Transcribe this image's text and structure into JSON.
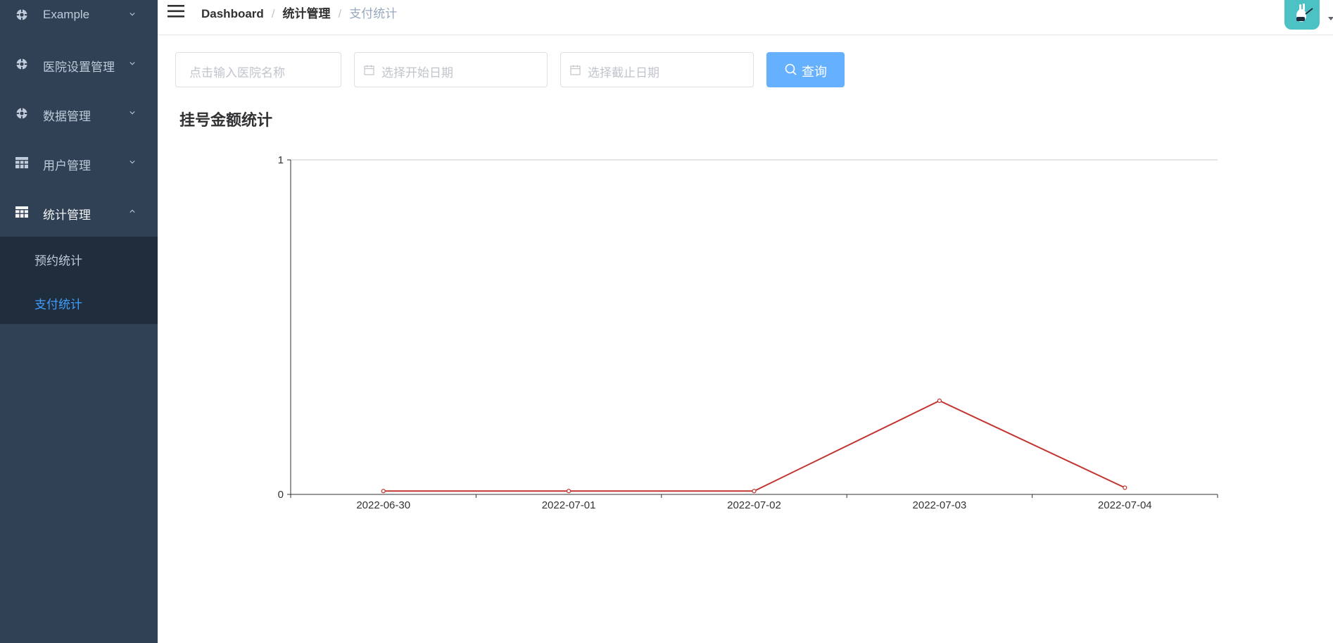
{
  "sidebar": {
    "items": [
      {
        "label": "Example",
        "icon": "example-icon",
        "expanded": false
      },
      {
        "label": "医院设置管理",
        "icon": "example-icon",
        "expanded": false
      },
      {
        "label": "数据管理",
        "icon": "example-icon",
        "expanded": false
      },
      {
        "label": "用户管理",
        "icon": "table-icon",
        "expanded": false
      },
      {
        "label": "统计管理",
        "icon": "table-icon",
        "expanded": true
      }
    ],
    "subitems": [
      {
        "label": "预约统计",
        "active": false
      },
      {
        "label": "支付统计",
        "active": true
      }
    ],
    "colors": {
      "background": "#304156",
      "submenu_background": "#1f2d3d",
      "text": "#bfcbd9",
      "active": "#409eff"
    }
  },
  "navbar": {
    "breadcrumb": [
      "Dashboard",
      "统计管理",
      "支付统计"
    ],
    "avatar_color": "#4cc2c4"
  },
  "filters": {
    "hospital_placeholder": "点击输入医院名称",
    "start_date_placeholder": "选择开始日期",
    "end_date_placeholder": "选择截止日期",
    "query_label": "查询",
    "query_button_color": "#66b1ff"
  },
  "chart_title": "挂号金额统计",
  "chart_data": {
    "type": "line",
    "title": "挂号金额统计",
    "categories": [
      "2022-06-30",
      "2022-07-01",
      "2022-07-02",
      "2022-07-03",
      "2022-07-04"
    ],
    "series": [
      {
        "values": [
          0.01,
          0.01,
          0.01,
          0.28,
          0.02
        ],
        "color": "#c23531"
      }
    ],
    "y_ticks": [
      "0",
      "1"
    ],
    "ylim": [
      0,
      1
    ],
    "grid": true,
    "legend": false,
    "xlabel": "",
    "ylabel": ""
  }
}
